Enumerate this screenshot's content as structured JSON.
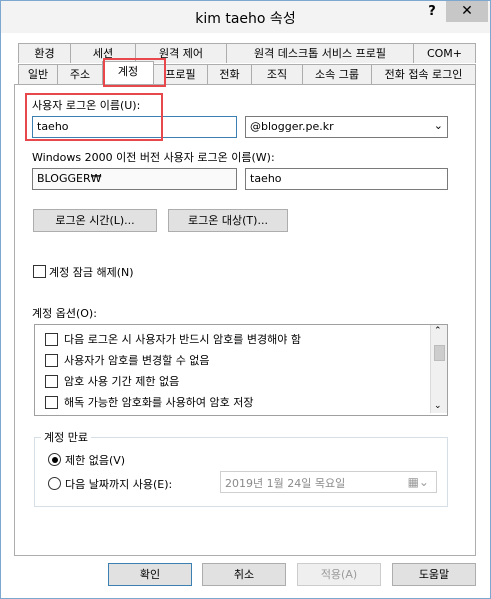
{
  "window": {
    "title": "kim taeho 속성",
    "help": "?",
    "close": "✕"
  },
  "tabs_back": [
    "환경",
    "세션",
    "원격 제어",
    "원격 데스크톱 서비스 프로필",
    "COM+"
  ],
  "tabs_front": [
    "일반",
    "주소",
    "계정",
    "프로필",
    "전화",
    "조직",
    "소속 그룹",
    "전화 접속 로그인"
  ],
  "account": {
    "logon_name_label": "사용자 로그온 이름(U):",
    "logon_name_value": "taeho",
    "domain_value": "@blogger.pe.kr",
    "pre2000_label": "Windows 2000 이전 버전 사용자 로그온 이름(W):",
    "pre2000_domain": "BLOGGER₩",
    "pre2000_user": "taeho",
    "logon_hours_button": "로그온 시간(L)...",
    "logon_to_button": "로그온 대상(T)...",
    "unlock_label": "계정 잠금 해제(N)",
    "options_label": "계정 옵션(O):",
    "options": [
      "다음 로그온 시 사용자가 반드시 암호를 변경해야 함",
      "사용자가 암호를 변경할 수 없음",
      "암호 사용 기간 제한 없음",
      "해독 가능한 암호화를 사용하여 암호 저장"
    ],
    "expires_group": "계정 만료",
    "never_label": "제한 없음(V)",
    "end_of_label": "다음 날짜까지 사용(E):",
    "date_value": "2019년   1월 24일 목요일"
  },
  "footer": {
    "ok": "확인",
    "cancel": "취소",
    "apply": "적용(A)",
    "help": "도움말"
  },
  "colors": {
    "highlight": "#e8474c",
    "focus": "#3c7fb1"
  }
}
